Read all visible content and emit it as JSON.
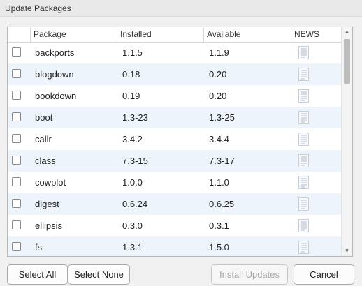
{
  "window": {
    "title": "Update Packages"
  },
  "table": {
    "columns": {
      "package": "Package",
      "installed": "Installed",
      "available": "Available",
      "news": "NEWS"
    },
    "rows": [
      {
        "package": "backports",
        "installed": "1.1.5",
        "available": "1.1.9"
      },
      {
        "package": "blogdown",
        "installed": "0.18",
        "available": "0.20"
      },
      {
        "package": "bookdown",
        "installed": "0.19",
        "available": "0.20"
      },
      {
        "package": "boot",
        "installed": "1.3-23",
        "available": "1.3-25"
      },
      {
        "package": "callr",
        "installed": "3.4.2",
        "available": "3.4.4"
      },
      {
        "package": "class",
        "installed": "7.3-15",
        "available": "7.3-17"
      },
      {
        "package": "cowplot",
        "installed": "1.0.0",
        "available": "1.1.0"
      },
      {
        "package": "digest",
        "installed": "0.6.24",
        "available": "0.6.25"
      },
      {
        "package": "ellipsis",
        "installed": "0.3.0",
        "available": "0.3.1"
      },
      {
        "package": "fs",
        "installed": "1.3.1",
        "available": "1.5.0"
      }
    ],
    "row_checked": false,
    "news_icon": "news-document-icon"
  },
  "buttons": {
    "select_all": "Select All",
    "select_none": "Select None",
    "install_updates": "Install Updates",
    "install_updates_enabled": false,
    "cancel": "Cancel"
  },
  "colors": {
    "row_alt": "#eef4fb",
    "background": "#f0f0f0"
  }
}
